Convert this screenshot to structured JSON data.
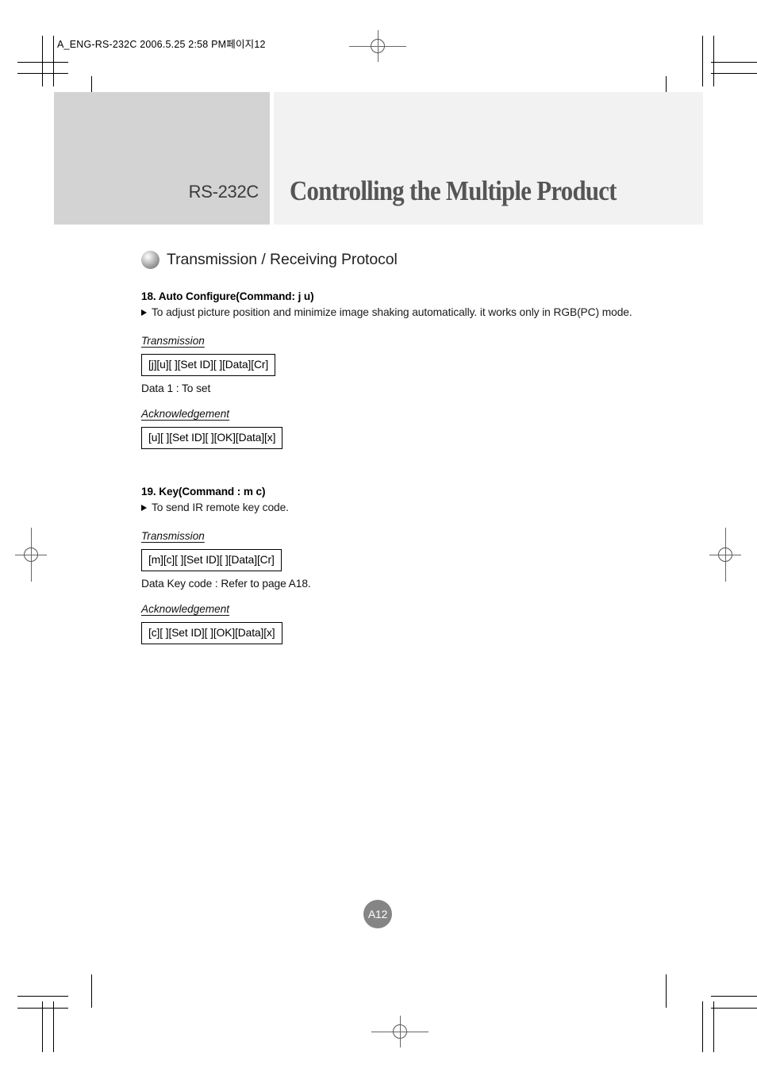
{
  "file_header": "A_ENG-RS-232C  2006.5.25  2:58 PM페이지12",
  "banner": {
    "subtitle": "RS-232C",
    "title": "Controlling the Multiple Product"
  },
  "section": {
    "icon": "sphere-bullet-icon",
    "heading": "Transmission / Receiving Protocol"
  },
  "commands": [
    {
      "number_title": "18. Auto Configure(Command: j u)",
      "description": "To adjust picture position and minimize image shaking automatically. it works only in RGB(PC) mode.",
      "transmission_label": "Transmission",
      "transmission_code": "[j][u][ ][Set ID][ ][Data][Cr]",
      "data_note": "Data 1 : To set",
      "ack_label": "Acknowledgement",
      "ack_code": "[u][ ][Set ID][ ][OK][Data][x]"
    },
    {
      "number_title": "19. Key(Command : m c)",
      "description": "To send IR remote key code.",
      "transmission_label": "Transmission",
      "transmission_code": "[m][c][ ][Set ID][ ][Data][Cr]",
      "data_note": "Data  Key code : Refer to page A18.",
      "ack_label": "Acknowledgement",
      "ack_code": "[c][ ][Set ID][ ][OK][Data][x]"
    }
  ],
  "page_number": "A12",
  "colors": {
    "banner_left": "#d3d3d3",
    "banner_right": "#f2f2f2",
    "title_text": "#555555",
    "page_badge": "#858585"
  }
}
